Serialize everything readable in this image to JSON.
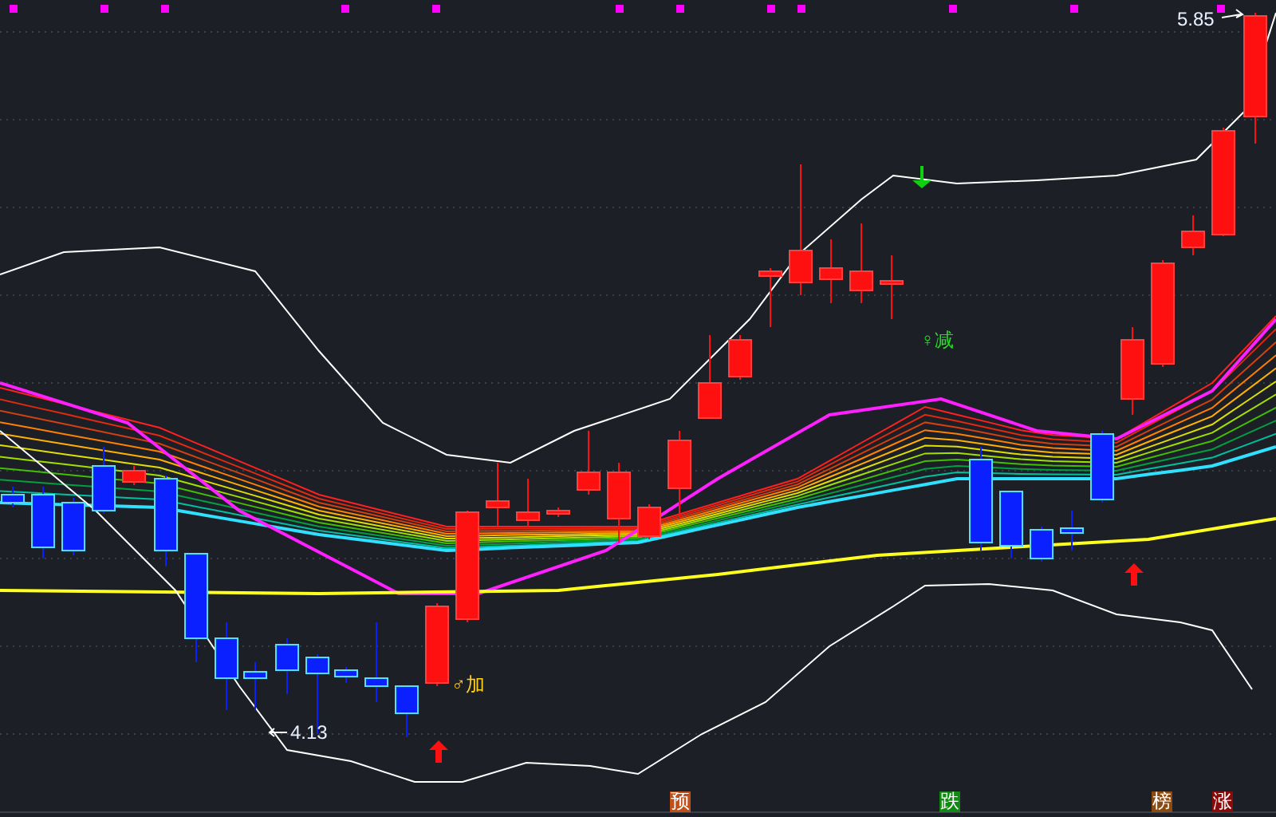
{
  "chart": {
    "high_label": "5.85",
    "low_label": "4.13",
    "signals": [
      {
        "kind": "add",
        "text": "♂加"
      },
      {
        "kind": "reduce",
        "text": "♀减"
      }
    ]
  },
  "badges": [
    {
      "text": "预",
      "color": "#c0501a"
    },
    {
      "text": "跌",
      "color": "#108a10"
    },
    {
      "text": "榜",
      "color": "#8a4a10"
    },
    {
      "text": "涨",
      "color": "#8a0a0a"
    }
  ]
}
